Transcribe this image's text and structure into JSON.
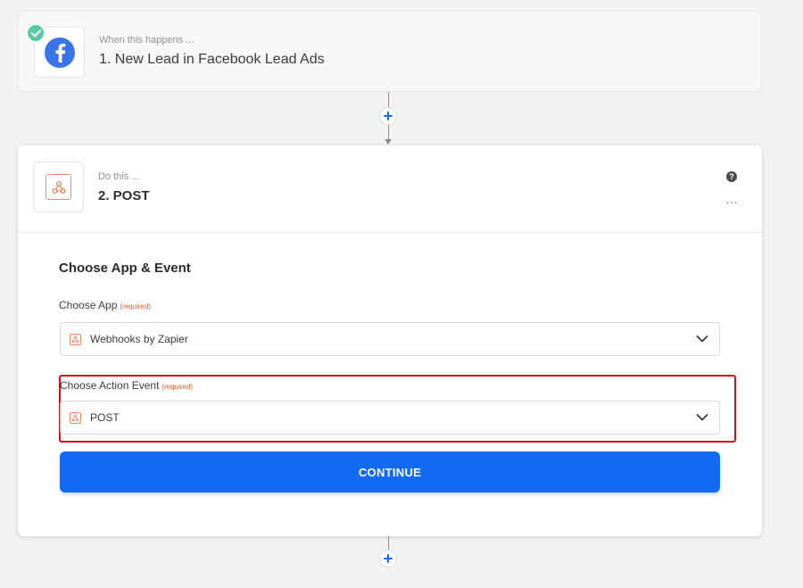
{
  "trigger": {
    "subtitle": "When this happens ...",
    "title": "1. New Lead in Facebook Lead Ads",
    "app_icon": "facebook-icon",
    "status_icon": "check-icon",
    "status_color": "#5ecaa5"
  },
  "action": {
    "subtitle": "Do this ...",
    "title": "2. POST",
    "app_icon": "webhook-icon",
    "help_icon": "question-icon",
    "menu_icon": "more-icon",
    "menu_text": "...",
    "help_text": "?"
  },
  "form": {
    "section_title": "Choose App & Event",
    "app_field": {
      "label": "Choose App",
      "required": "(required)",
      "value": "Webhooks by Zapier"
    },
    "event_field": {
      "label": "Choose Action Event",
      "required": "(required)",
      "value": "POST"
    },
    "continue_label": "CONTINUE"
  },
  "colors": {
    "accent": "#136bf5",
    "highlight": "#d4111a",
    "required": "#e05a2b",
    "webhook": "#f08a5d"
  }
}
